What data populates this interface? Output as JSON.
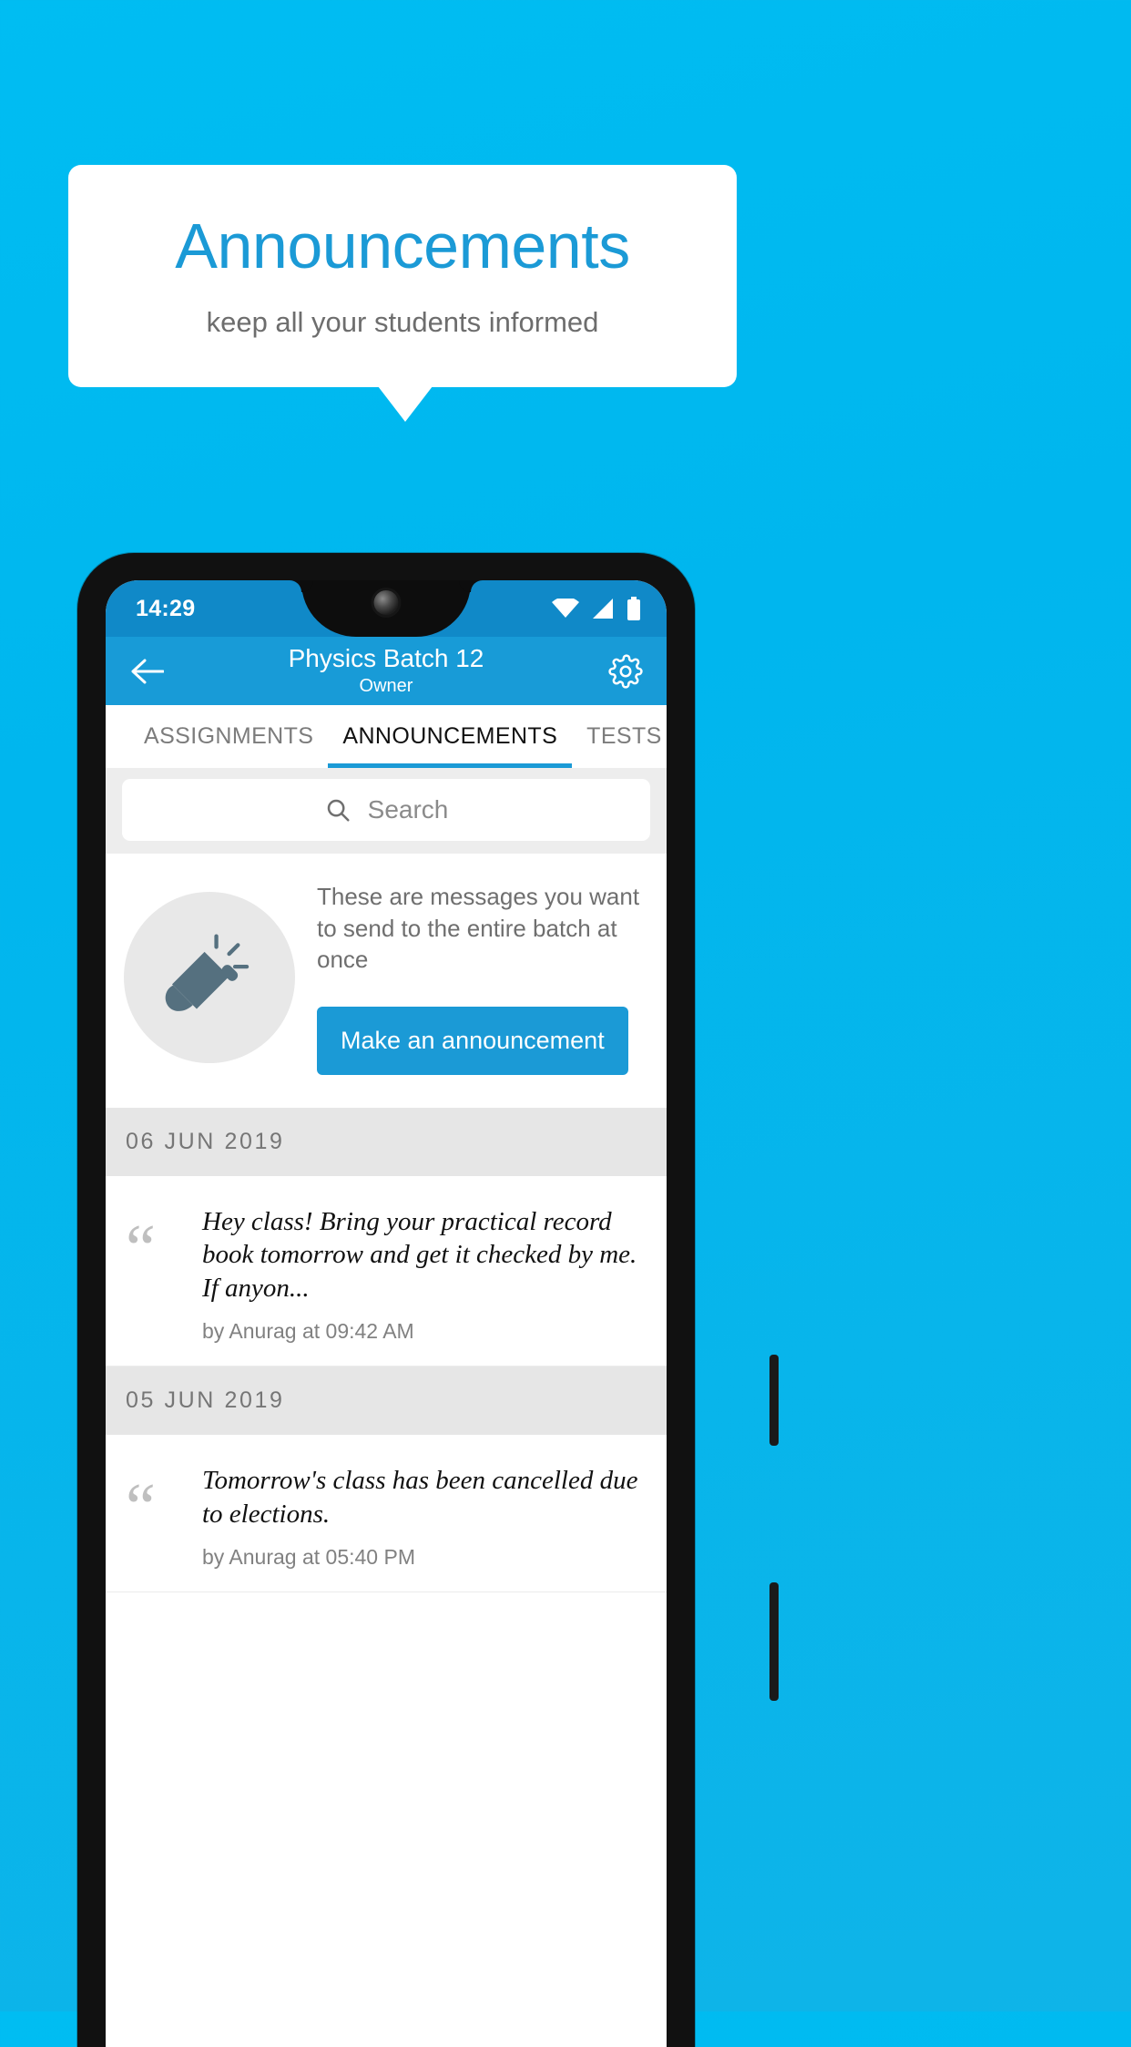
{
  "promo": {
    "title": "Announcements",
    "subtitle": "keep all your students informed",
    "title_color": "#1b9ad6",
    "bg_color": "#00b8ef"
  },
  "status_bar": {
    "time": "14:29",
    "icons": [
      "wifi-icon",
      "signal-icon",
      "battery-icon"
    ]
  },
  "app_bar": {
    "back_icon": "back-arrow-icon",
    "title": "Physics Batch 12",
    "subtitle": "Owner",
    "settings_icon": "gear-icon",
    "bg_color": "#189bd7"
  },
  "tabs": [
    {
      "label": "ASSIGNMENTS",
      "active": false
    },
    {
      "label": "ANNOUNCEMENTS",
      "active": true
    },
    {
      "label": "TESTS",
      "active": false
    }
  ],
  "search": {
    "icon": "search-icon",
    "placeholder": "Search",
    "value": ""
  },
  "intro": {
    "icon": "megaphone-icon",
    "text": "These are messages you want to send to the entire batch at once",
    "button_label": "Make an announcement",
    "button_color": "#1b9ad6"
  },
  "groups": [
    {
      "date": "06  JUN  2019",
      "items": [
        {
          "quote_icon": "quote-mark-icon",
          "text": "Hey class! Bring your practical record book tomorrow and get it checked by me. If anyon...",
          "byline": "by Anurag at 09:42 AM"
        }
      ]
    },
    {
      "date": "05  JUN  2019",
      "items": [
        {
          "quote_icon": "quote-mark-icon",
          "text": "Tomorrow's class has been cancelled due to elections.",
          "byline": "by Anurag at 05:40 PM"
        }
      ]
    }
  ]
}
